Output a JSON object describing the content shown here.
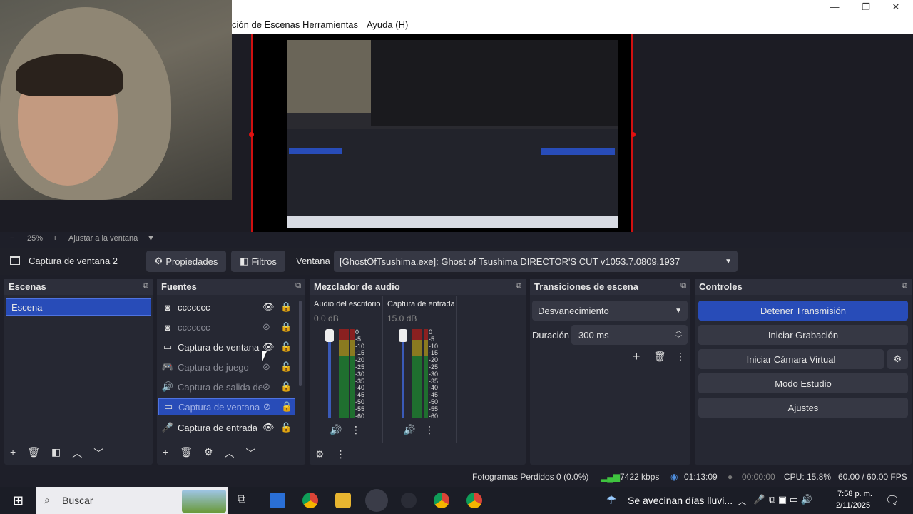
{
  "menu": {
    "item_scenes": "ción de Escenas",
    "item_tools": "Herramientas",
    "item_help": "Ayuda (H)"
  },
  "preview": {
    "zoom": "25%",
    "fit_label": "Ajustar a la ventana"
  },
  "source_bar": {
    "source_name": "Captura de ventana 2",
    "properties": "Propiedades",
    "filters": "Filtros",
    "window_label": "Ventana",
    "window_value": "[GhostOfTsushima.exe]: Ghost of Tsushima DIRECTOR'S CUT v1053.7.0809.1937"
  },
  "scenes": {
    "title": "Escenas",
    "items": [
      "Escena"
    ]
  },
  "sources": {
    "title": "Fuentes",
    "items": [
      "ccccccc",
      "ccccccc",
      "Captura de ventana",
      "Captura de juego",
      "Captura de salida de",
      "Captura de ventana",
      "Captura de entrada"
    ]
  },
  "mixer": {
    "title": "Mezclador de audio",
    "ch1_name": "Audio del escritorio",
    "ch1_db": "0.0 dB",
    "ch2_name": "Captura de entrada",
    "ch2_db": "15.0 dB",
    "scale": [
      "0",
      "-5",
      "-10",
      "-15",
      "-20",
      "-25",
      "-30",
      "-35",
      "-40",
      "-45",
      "-50",
      "-55",
      "-60"
    ]
  },
  "transitions": {
    "title": "Transiciones de escena",
    "type": "Desvanecimiento",
    "duration_label": "Duración",
    "duration_value": "300 ms"
  },
  "controls": {
    "title": "Controles",
    "stop_stream": "Detener Transmisión",
    "start_record": "Iniciar Grabación",
    "virtual_cam": "Iniciar Cámara Virtual",
    "studio": "Modo Estudio",
    "settings": "Ajustes"
  },
  "status": {
    "dropped": "Fotogramas Perdidos 0 (0.0%)",
    "kbps": "7422 kbps",
    "stream_time": "01:13:09",
    "rec_time": "00:00:00",
    "cpu": "CPU: 15.8%",
    "fps": "60.00 / 60.00 FPS"
  },
  "taskbar": {
    "search": "Buscar",
    "weather": "Se avecinan días lluvi...",
    "time": "7:58 p. m.",
    "date": "2/11/2025"
  },
  "colors": {
    "accent": "#284cb8",
    "record": "#d01010"
  }
}
